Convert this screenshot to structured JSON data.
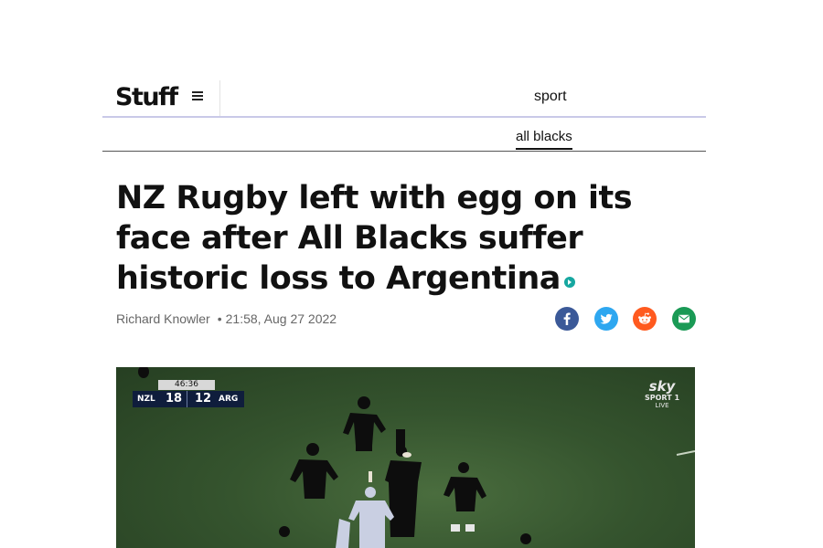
{
  "header": {
    "logo": "Stuff",
    "menu_icon": "hamburger-menu-icon",
    "section": "sport"
  },
  "subnav": {
    "active_item": "all blacks"
  },
  "article": {
    "headline": "NZ Rugby left with egg on its face after All Blacks suffer historic loss to Argentina",
    "author": "Richard Knowler",
    "separator": "•",
    "timestamp": "21:58, Aug 27 2022",
    "video_indicator_icon": "play-dot-icon"
  },
  "share": {
    "facebook_icon": "facebook-icon",
    "twitter_icon": "twitter-icon",
    "reddit_icon": "reddit-icon",
    "email_icon": "email-icon",
    "colors": {
      "facebook": "#3b5998",
      "twitter": "#2ea7f0",
      "reddit": "#ff5a1f",
      "email": "#1a9a55"
    }
  },
  "video": {
    "scoreboard": {
      "clock": "46:36",
      "home_team": "NZL",
      "home_score": "18",
      "away_score": "12",
      "away_team": "ARG"
    },
    "broadcaster": {
      "brand": "sky",
      "channel": "SPORT 1",
      "status": "LIVE"
    }
  }
}
